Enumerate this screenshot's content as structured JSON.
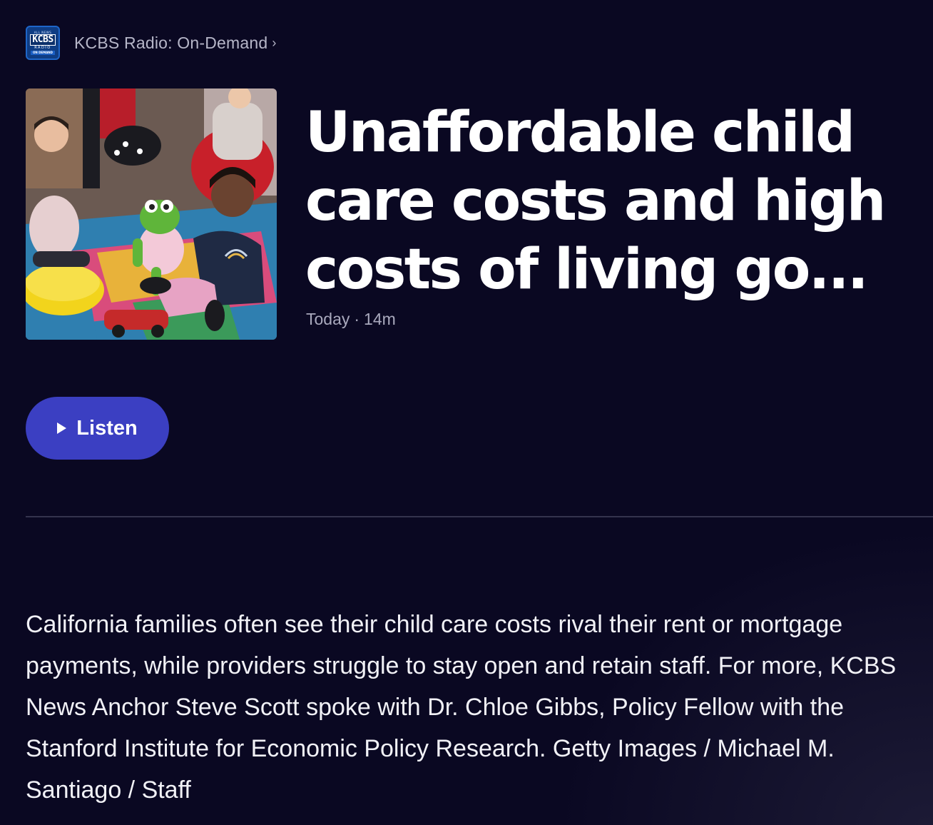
{
  "podcast": {
    "name": "KCBS Radio: On-Demand",
    "chevron": "›",
    "logo": {
      "top": "ALL NEWS",
      "main": "KCBS",
      "sub": "RADIO",
      "foot": "ON DEMAND"
    }
  },
  "episode": {
    "title": "Unaffordable child care costs and high costs of living go...",
    "date": "Today",
    "separator": "·",
    "duration": "14m",
    "artwork_icon": "episode-artwork"
  },
  "actions": {
    "listen_label": "Listen",
    "play_icon": "play-icon"
  },
  "description": "California families often see their child care costs rival their rent or mortgage payments, while providers struggle to stay open and retain staff. For more, KCBS News Anchor Steve Scott spoke with Dr. Chloe Gibbs, Policy Fellow with the Stanford Institute for Economic Policy Research. Getty Images / Michael M. Santiago / Staff",
  "colors": {
    "background": "#0a0822",
    "accent": "#3b3fc2",
    "muted_text": "#a9a9bd"
  }
}
